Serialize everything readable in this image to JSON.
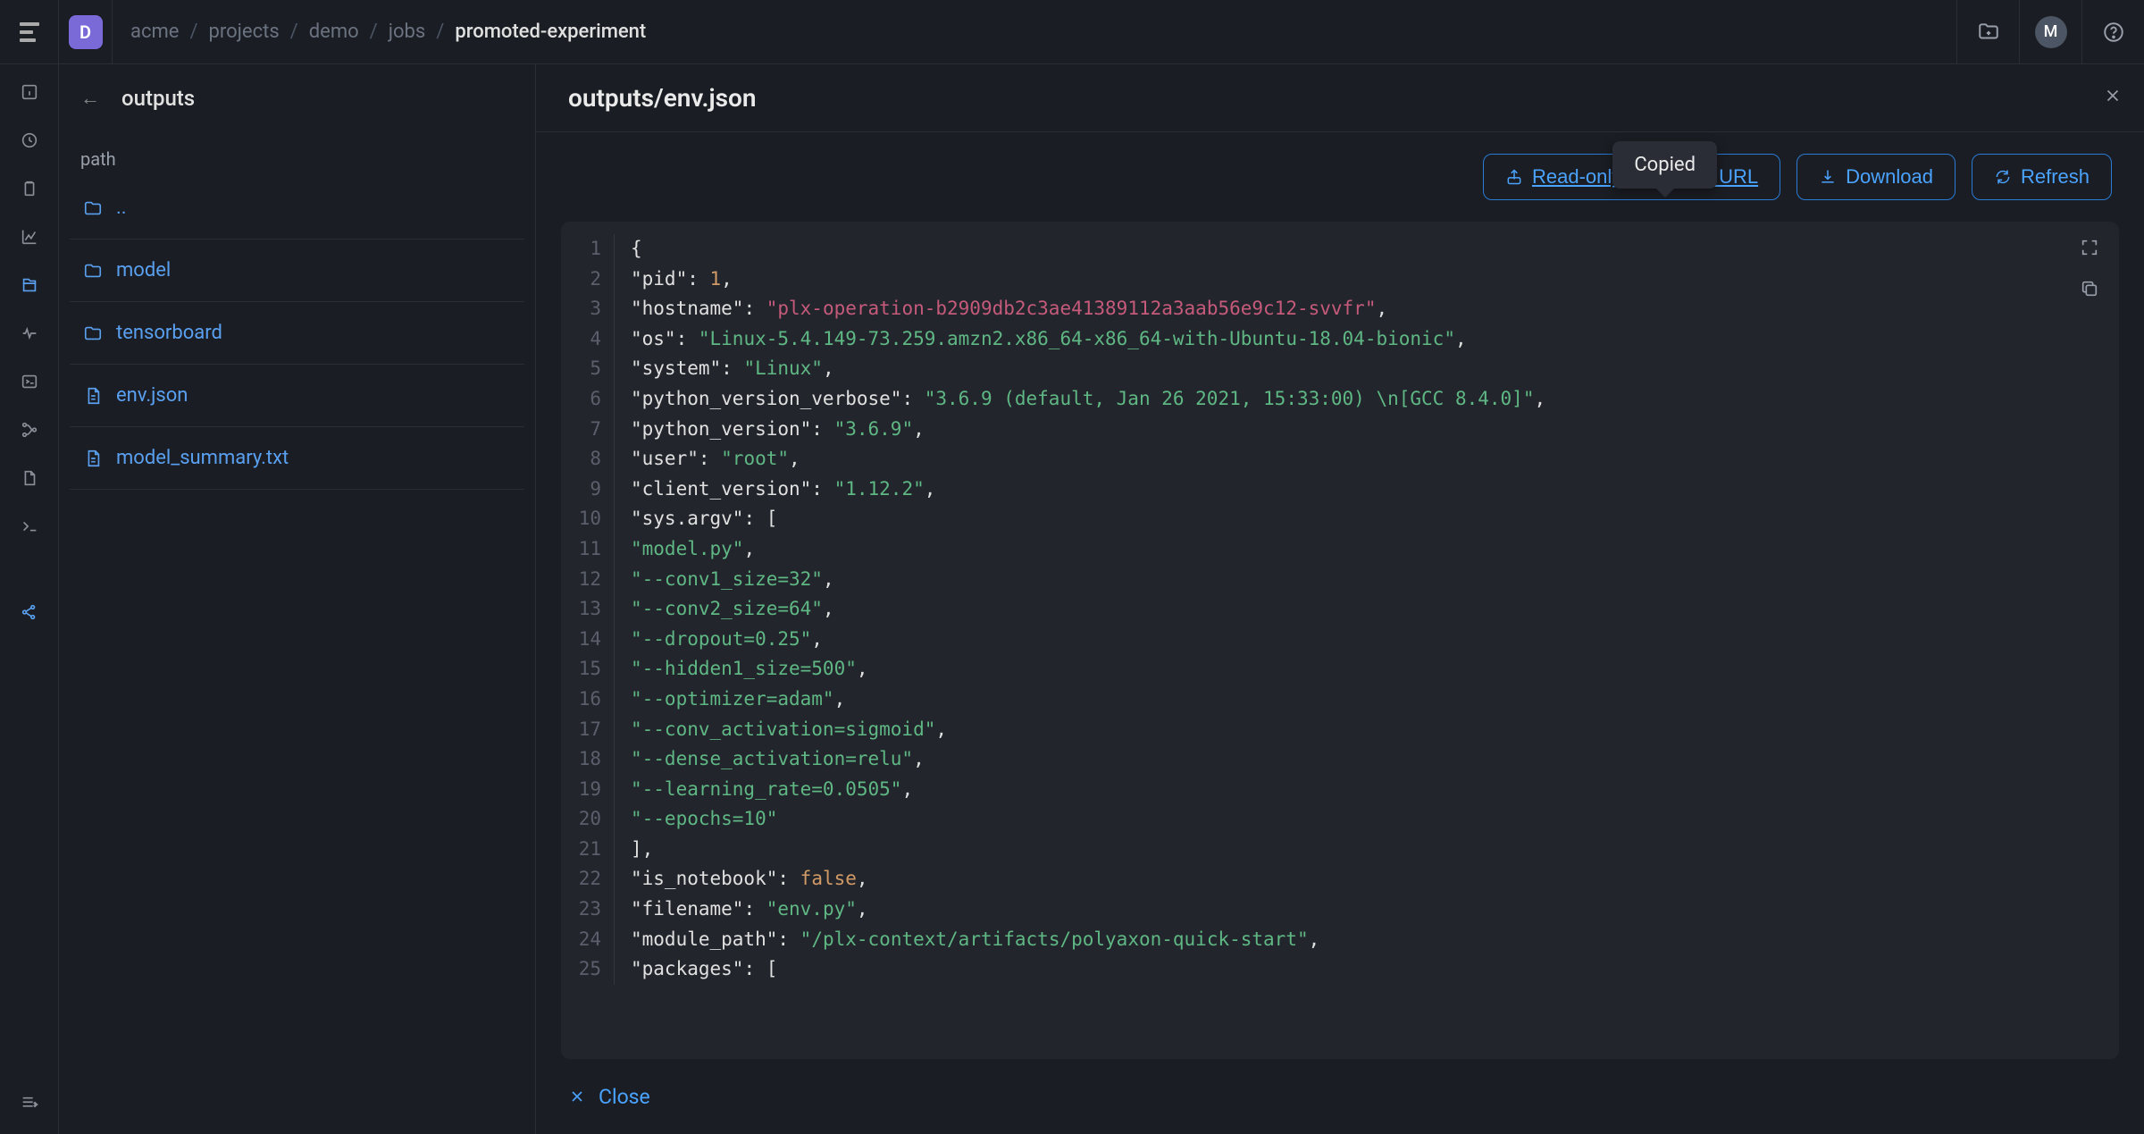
{
  "topbar": {
    "project_letter": "D",
    "breadcrumbs": [
      "acme",
      "projects",
      "demo",
      "jobs",
      "promoted-experiment"
    ],
    "avatar_letter": "M"
  },
  "tree": {
    "back_label": "←",
    "header": "outputs",
    "column_label": "path",
    "items": [
      {
        "type": "folder",
        "name": ".."
      },
      {
        "type": "folder",
        "name": "model"
      },
      {
        "type": "folder",
        "name": "tensorboard"
      },
      {
        "type": "file",
        "name": "env.json"
      },
      {
        "type": "file",
        "name": "model_summary.txt"
      }
    ]
  },
  "content": {
    "title": "outputs/env.json",
    "tooltip": "Copied",
    "actions": {
      "share": "Read-only shareable URL",
      "download": "Download",
      "refresh": "Refresh"
    },
    "code_lines": [
      [
        {
          "t": "punc",
          "v": "{"
        }
      ],
      [
        {
          "t": "indent",
          "v": 1
        },
        {
          "t": "key",
          "v": "\"pid\""
        },
        {
          "t": "punc",
          "v": ": "
        },
        {
          "t": "num",
          "v": "1"
        },
        {
          "t": "punc",
          "v": ","
        }
      ],
      [
        {
          "t": "indent",
          "v": 1
        },
        {
          "t": "key",
          "v": "\"hostname\""
        },
        {
          "t": "punc",
          "v": ": "
        },
        {
          "t": "hostname",
          "v": "\"plx-operation-b2909db2c3ae41389112a3aab56e9c12-svvfr\""
        },
        {
          "t": "punc",
          "v": ","
        }
      ],
      [
        {
          "t": "indent",
          "v": 1
        },
        {
          "t": "key",
          "v": "\"os\""
        },
        {
          "t": "punc",
          "v": ": "
        },
        {
          "t": "str",
          "v": "\"Linux-5.4.149-73.259.amzn2.x86_64-x86_64-with-Ubuntu-18.04-bionic\""
        },
        {
          "t": "punc",
          "v": ","
        }
      ],
      [
        {
          "t": "indent",
          "v": 1
        },
        {
          "t": "key",
          "v": "\"system\""
        },
        {
          "t": "punc",
          "v": ": "
        },
        {
          "t": "str",
          "v": "\"Linux\""
        },
        {
          "t": "punc",
          "v": ","
        }
      ],
      [
        {
          "t": "indent",
          "v": 1
        },
        {
          "t": "key",
          "v": "\"python_version_verbose\""
        },
        {
          "t": "punc",
          "v": ": "
        },
        {
          "t": "str",
          "v": "\"3.6.9 (default, Jan 26 2021, 15:33:00) \\n[GCC 8.4.0]\""
        },
        {
          "t": "punc",
          "v": ","
        }
      ],
      [
        {
          "t": "indent",
          "v": 1
        },
        {
          "t": "key",
          "v": "\"python_version\""
        },
        {
          "t": "punc",
          "v": ": "
        },
        {
          "t": "str",
          "v": "\"3.6.9\""
        },
        {
          "t": "punc",
          "v": ","
        }
      ],
      [
        {
          "t": "indent",
          "v": 1
        },
        {
          "t": "key",
          "v": "\"user\""
        },
        {
          "t": "punc",
          "v": ": "
        },
        {
          "t": "str",
          "v": "\"root\""
        },
        {
          "t": "punc",
          "v": ","
        }
      ],
      [
        {
          "t": "indent",
          "v": 1
        },
        {
          "t": "key",
          "v": "\"client_version\""
        },
        {
          "t": "punc",
          "v": ": "
        },
        {
          "t": "str",
          "v": "\"1.12.2\""
        },
        {
          "t": "punc",
          "v": ","
        }
      ],
      [
        {
          "t": "indent",
          "v": 1
        },
        {
          "t": "key",
          "v": "\"sys.argv\""
        },
        {
          "t": "punc",
          "v": ": ["
        }
      ],
      [
        {
          "t": "indent",
          "v": 2
        },
        {
          "t": "str",
          "v": "\"model.py\""
        },
        {
          "t": "punc",
          "v": ","
        }
      ],
      [
        {
          "t": "indent",
          "v": 2
        },
        {
          "t": "str",
          "v": "\"--conv1_size=32\""
        },
        {
          "t": "punc",
          "v": ","
        }
      ],
      [
        {
          "t": "indent",
          "v": 2
        },
        {
          "t": "str",
          "v": "\"--conv2_size=64\""
        },
        {
          "t": "punc",
          "v": ","
        }
      ],
      [
        {
          "t": "indent",
          "v": 2
        },
        {
          "t": "str",
          "v": "\"--dropout=0.25\""
        },
        {
          "t": "punc",
          "v": ","
        }
      ],
      [
        {
          "t": "indent",
          "v": 2
        },
        {
          "t": "str",
          "v": "\"--hidden1_size=500\""
        },
        {
          "t": "punc",
          "v": ","
        }
      ],
      [
        {
          "t": "indent",
          "v": 2
        },
        {
          "t": "str",
          "v": "\"--optimizer=adam\""
        },
        {
          "t": "punc",
          "v": ","
        }
      ],
      [
        {
          "t": "indent",
          "v": 2
        },
        {
          "t": "str",
          "v": "\"--conv_activation=sigmoid\""
        },
        {
          "t": "punc",
          "v": ","
        }
      ],
      [
        {
          "t": "indent",
          "v": 2
        },
        {
          "t": "str",
          "v": "\"--dense_activation=relu\""
        },
        {
          "t": "punc",
          "v": ","
        }
      ],
      [
        {
          "t": "indent",
          "v": 2
        },
        {
          "t": "str",
          "v": "\"--learning_rate=0.0505\""
        },
        {
          "t": "punc",
          "v": ","
        }
      ],
      [
        {
          "t": "indent",
          "v": 2
        },
        {
          "t": "str",
          "v": "\"--epochs=10\""
        }
      ],
      [
        {
          "t": "indent",
          "v": 1
        },
        {
          "t": "punc",
          "v": "],"
        }
      ],
      [
        {
          "t": "indent",
          "v": 1
        },
        {
          "t": "key",
          "v": "\"is_notebook\""
        },
        {
          "t": "punc",
          "v": ": "
        },
        {
          "t": "kw",
          "v": "false"
        },
        {
          "t": "punc",
          "v": ","
        }
      ],
      [
        {
          "t": "indent",
          "v": 1
        },
        {
          "t": "key",
          "v": "\"filename\""
        },
        {
          "t": "punc",
          "v": ": "
        },
        {
          "t": "str",
          "v": "\"env.py\""
        },
        {
          "t": "punc",
          "v": ","
        }
      ],
      [
        {
          "t": "indent",
          "v": 1
        },
        {
          "t": "key",
          "v": "\"module_path\""
        },
        {
          "t": "punc",
          "v": ": "
        },
        {
          "t": "str",
          "v": "\"/plx-context/artifacts/polyaxon-quick-start\""
        },
        {
          "t": "punc",
          "v": ","
        }
      ],
      [
        {
          "t": "indent",
          "v": 1
        },
        {
          "t": "key",
          "v": "\"packages\""
        },
        {
          "t": "punc",
          "v": ": ["
        }
      ]
    ],
    "footer_close": "Close"
  },
  "colors": {
    "accent": "#4aa3ff",
    "string": "#5fb784",
    "number": "#d19a66",
    "hostname": "#c55a7a"
  }
}
